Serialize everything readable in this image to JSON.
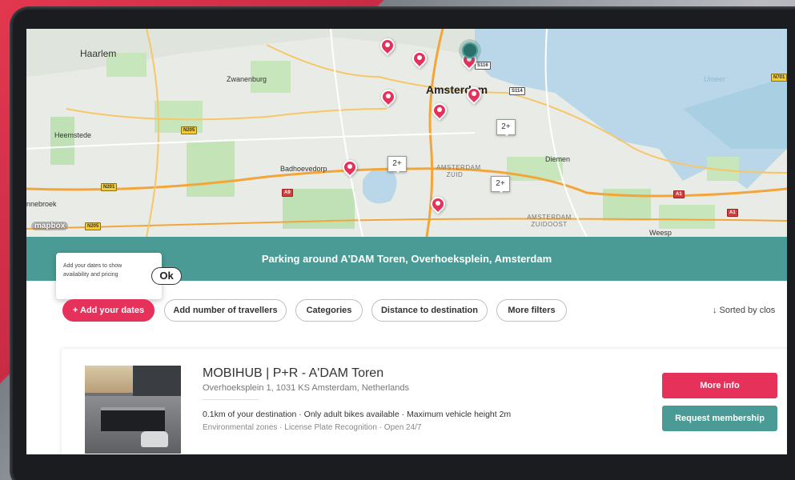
{
  "map": {
    "places": [
      "Haarlem",
      "Zwanenburg",
      "Amsterdam",
      "Heemstede",
      "Badhoevedorp",
      "Diemen",
      "Umeer",
      "nnebroek",
      "Weesp"
    ],
    "districts": [
      "AMSTERDAM ZUID",
      "AMSTERDAM ZUIDOOST"
    ],
    "road_shields": [
      "S116",
      "S114",
      "N205",
      "N201",
      "A9",
      "A1",
      "N205",
      "A1",
      "N701"
    ],
    "clusters": [
      "2+",
      "2+",
      "2+"
    ],
    "attribution": "mapbox",
    "pin_color": "#e6315b",
    "current_location_color": "#2b6f6b"
  },
  "banner": {
    "text": "Parking around A'DAM Toren, Overhoeksplein, Amsterdam"
  },
  "tooltip": {
    "text": "Add your dates to show availability and pricing",
    "ok_label": "Ok"
  },
  "filters": {
    "add_dates": "+ Add your dates",
    "travellers": "Add number of travellers",
    "categories": "Categories",
    "distance": "Distance to destination",
    "more_filters": "More filters",
    "sorted": "↓ Sorted by clos"
  },
  "result": {
    "title": "MOBIHUB | P+R - A'DAM Toren",
    "address": "Overhoeksplein 1, 1031 KS Amsterdam, Netherlands",
    "features": "0.1km of your destination · Only adult bikes available · Maximum vehicle height 2m",
    "features_secondary": "Environmental zones · License Plate Recognition · Open 24/7",
    "more_info": "More info",
    "request_membership": "Request membership"
  },
  "colors": {
    "accent": "#e6315b",
    "teal": "#4a9b96"
  }
}
